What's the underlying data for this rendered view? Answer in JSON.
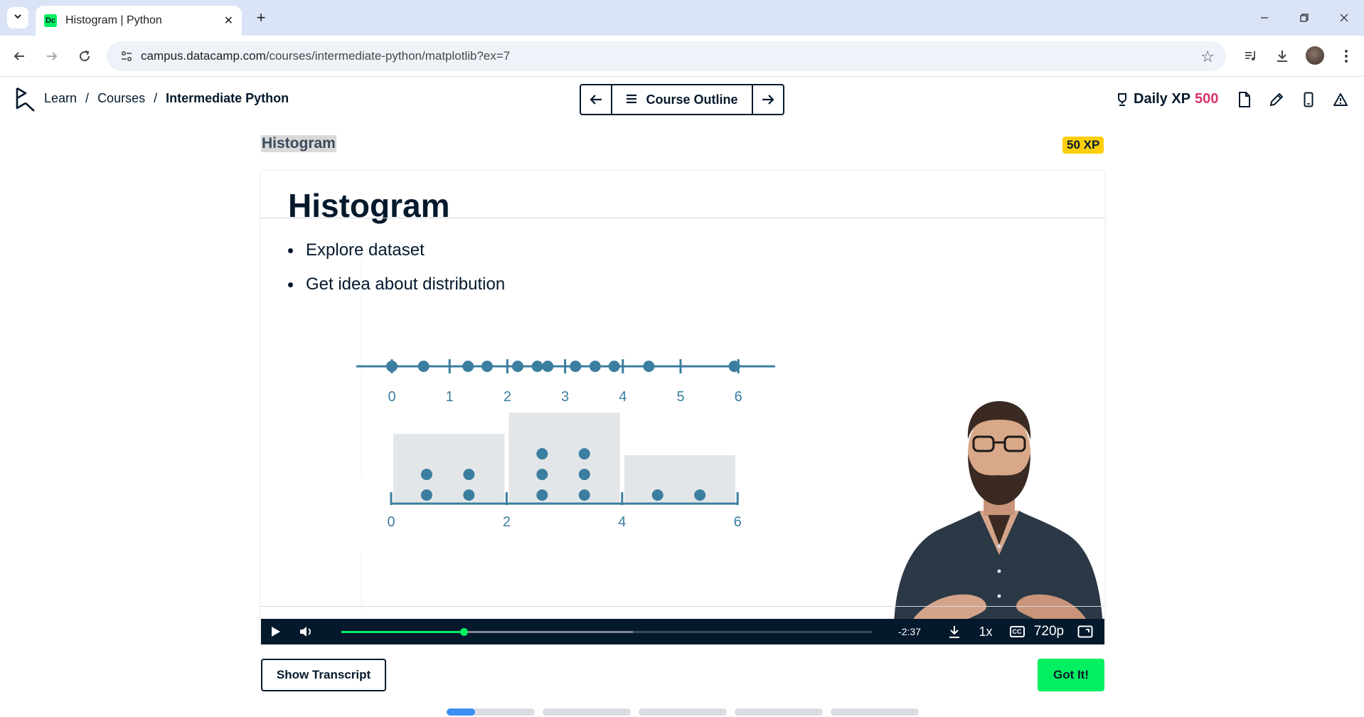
{
  "browser": {
    "tab_title": "Histogram | Python",
    "favicon_text": "Dc",
    "url_host": "campus.datacamp.com",
    "url_path": "/courses/intermediate-python/matplotlib?ex=7"
  },
  "header": {
    "breadcrumb": [
      "Learn",
      "Courses",
      "Intermediate Python"
    ],
    "outline_label": "Course Outline",
    "daily_xp_label": "Daily XP",
    "daily_xp_value": "500"
  },
  "lesson": {
    "title": "Histogram",
    "xp_badge": "50 XP"
  },
  "slide": {
    "title": "Histogram",
    "bullets": [
      "Explore dataset",
      "Get idea about distribution"
    ],
    "number_line": {
      "ticks": [
        0,
        1,
        2,
        3,
        4,
        5,
        6
      ],
      "points": [
        0,
        0.55,
        1.32,
        1.65,
        2.18,
        2.52,
        2.7,
        3.18,
        3.52,
        3.85,
        4.45,
        5.93
      ]
    },
    "histogram": {
      "ticks": [
        0,
        2,
        4,
        6
      ],
      "bins": [
        {
          "from": 0,
          "to": 2,
          "count": 4
        },
        {
          "from": 2,
          "to": 4,
          "count": 6
        },
        {
          "from": 4,
          "to": 6,
          "count": 2
        }
      ]
    }
  },
  "player": {
    "time_remaining": "-2:37",
    "speed": "1x",
    "cc": "CC",
    "quality": "720p",
    "played_fraction": 0.23,
    "buffered_fraction": 0.55
  },
  "actions": {
    "transcript_label": "Show Transcript",
    "got_it_label": "Got It!"
  },
  "pager": {
    "segments": 5,
    "active_fraction": 0.32
  },
  "colors": {
    "accent_green": "#03ef62",
    "navy": "#05192d",
    "xp_pink": "#d8336b",
    "xp_badge": "#fcce0d",
    "diagram_blue": "#3b7ea0",
    "bin_gray": "#e3e6e8"
  },
  "icons": {
    "tab_menu": "chevron-down-icon",
    "back": "arrow-left-icon",
    "forward": "arrow-right-icon",
    "reload": "reload-icon",
    "site_info": "tune-icon",
    "bookmark": "star-icon",
    "media": "media-control-icon",
    "downloads": "download-icon",
    "menu": "kebab-icon",
    "trophy": "trophy-icon",
    "notes": "document-icon",
    "edit": "pencil-icon",
    "mobile": "mobile-icon",
    "report": "warning-icon",
    "play": "play-icon",
    "volume": "volume-icon",
    "fullscreen": "fullscreen-icon"
  }
}
